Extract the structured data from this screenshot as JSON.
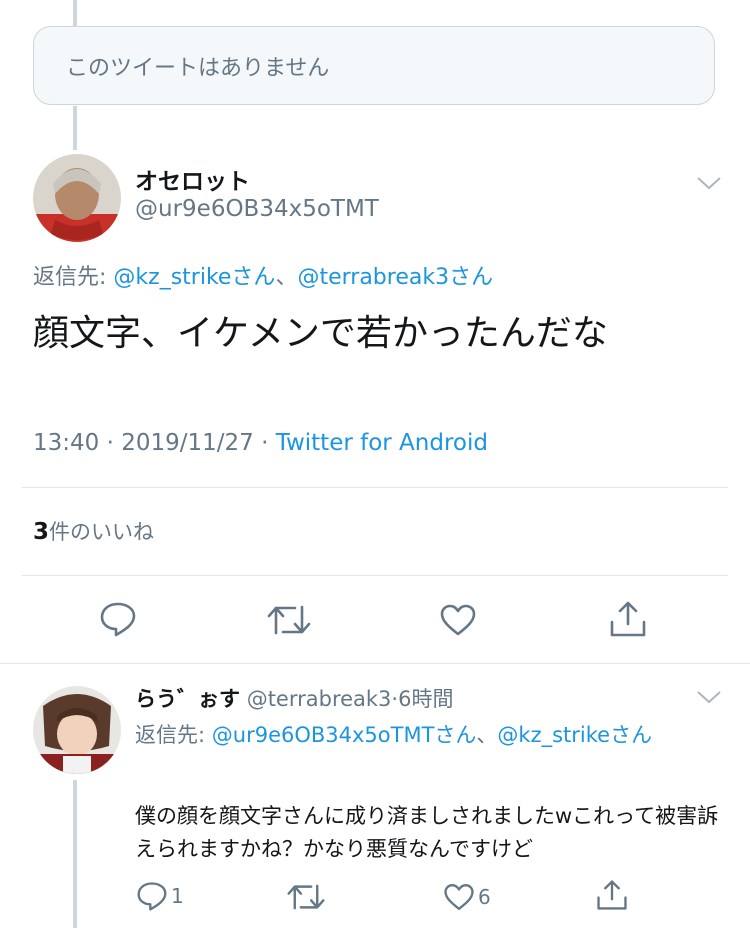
{
  "unavailable_tweet": {
    "text": "このツイートはありません"
  },
  "main_tweet": {
    "author_name": "オセロット",
    "handle": "@ur9e6OB34x5oTMT",
    "replying_prefix": "返信先: ",
    "replying_to_1": "@kz_strikeさん",
    "replying_sep": "、",
    "replying_to_2": "@terrabreak3さん",
    "text": "顔文字、イケメンで若かったんだな",
    "time": "13:40 · 2019/11/27 · ",
    "source": "Twitter for Android",
    "likes_count": "3",
    "likes_label": "件のいいね"
  },
  "reply_tweet": {
    "author_name": "らう゛ぉす",
    "handle": "@terrabreak3",
    "time": "·6時間",
    "replying_prefix": "返信先: ",
    "replying_to_1": "@ur9e6OB34x5oTMTさん",
    "replying_sep": "、",
    "replying_to_2": "@kz_strikeさん",
    "text": "僕の顔を顔文字さんに成り済ましされましたwこれって被害訴えられますかね？かなり悪質なんですけど",
    "reply_count": "1",
    "retweet_count": "",
    "like_count": "6"
  },
  "colors": {
    "link": "#1b95e0",
    "secondary": "#657786",
    "line": "#ccd6dd"
  },
  "icons": [
    "chevron-down-icon",
    "reply-icon",
    "retweet-icon",
    "like-icon",
    "share-icon"
  ]
}
